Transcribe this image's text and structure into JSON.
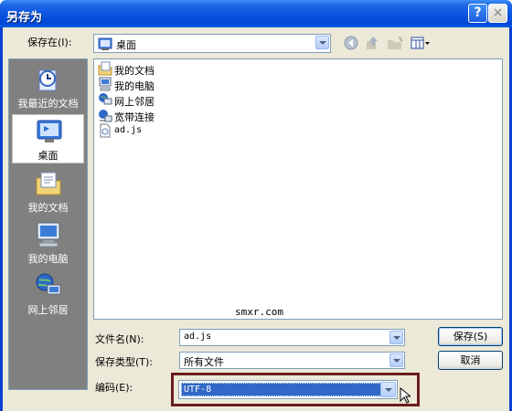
{
  "window": {
    "title": "另存为"
  },
  "toolbar": {
    "save_in_label": "保存在(I):",
    "location_value": "桌面"
  },
  "places": [
    {
      "label": "我最近的文档",
      "icon": "recent-documents-icon"
    },
    {
      "label": "桌面",
      "icon": "desktop-icon",
      "selected": true
    },
    {
      "label": "我的文档",
      "icon": "my-documents-icon"
    },
    {
      "label": "我的电脑",
      "icon": "my-computer-icon"
    },
    {
      "label": "网上邻居",
      "icon": "network-places-icon"
    }
  ],
  "files": [
    {
      "name": "我的文档",
      "icon": "my-documents-icon"
    },
    {
      "name": "我的电脑",
      "icon": "my-computer-icon"
    },
    {
      "name": "网上邻居",
      "icon": "network-places-icon"
    },
    {
      "name": "宽带连接",
      "icon": "broadband-connection-icon"
    },
    {
      "name": "ad.js",
      "icon": "script-file-icon"
    }
  ],
  "watermark": "smxr.com",
  "form": {
    "filename_label": "文件名(N):",
    "filename_value": "ad.js",
    "filetype_label": "保存类型(T):",
    "filetype_value": "所有文件",
    "encoding_label": "编码(E):",
    "encoding_value": "UTF-8"
  },
  "buttons": {
    "save": "保存(S)",
    "cancel": "取消"
  },
  "colors": {
    "titlebar": "#0a53e0",
    "dialog_bg": "#ece9d8",
    "selection": "#3169c6",
    "highlight_border": "#6a1d1d"
  }
}
